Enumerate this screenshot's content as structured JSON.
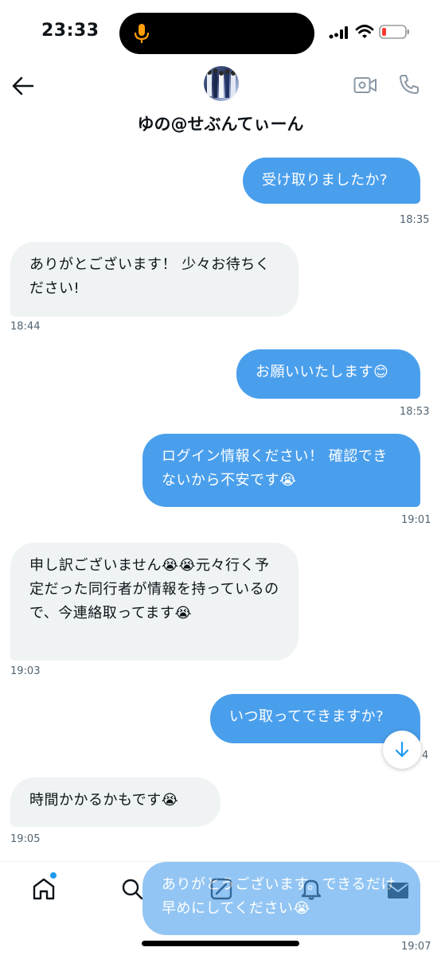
{
  "status_bar": {
    "time": "23:33",
    "icons": [
      "microphone-icon",
      "signal-icon",
      "wifi-icon",
      "battery-icon"
    ],
    "battery_low_color": "#ff3b30",
    "mic_color": "#ff9f0a"
  },
  "header": {
    "contact_name": "ゆの@せぶんてぃーん",
    "icons": [
      "back-arrow-icon",
      "video-call-icon",
      "phone-icon"
    ]
  },
  "colors": {
    "sent_bubble": "#4a9fec",
    "received_bubble": "#eff3f4",
    "accent": "#1d9bf0"
  },
  "messages": [
    {
      "direction": "sent",
      "text": "受け取りましたか?",
      "time": "18:35"
    },
    {
      "direction": "received",
      "text": "ありがとございます！ 少々お待ちください!",
      "time": "18:44"
    },
    {
      "direction": "sent",
      "text": "お願いいたします😊",
      "time": "18:53"
    },
    {
      "direction": "sent",
      "text": "ログイン情報ください！ 確認できないから不安です😭",
      "time": "19:01"
    },
    {
      "direction": "received",
      "text": "申し訳ございません😭😭元々行く予定だった同行者が情報を持っているので、今連絡取ってます😭",
      "time": "19:03"
    },
    {
      "direction": "sent",
      "text": "いつ取ってできますか?",
      "time": "4"
    },
    {
      "direction": "received",
      "text": "時間かかるかもです😭",
      "time": "19:05"
    },
    {
      "direction": "sent",
      "text": "ありがとうございます。できるだけ早めにしてください😭",
      "time": "19:07"
    }
  ],
  "bottom_nav": {
    "items": [
      "home-icon",
      "search-icon",
      "compose-icon",
      "notifications-icon",
      "messages-icon"
    ]
  }
}
